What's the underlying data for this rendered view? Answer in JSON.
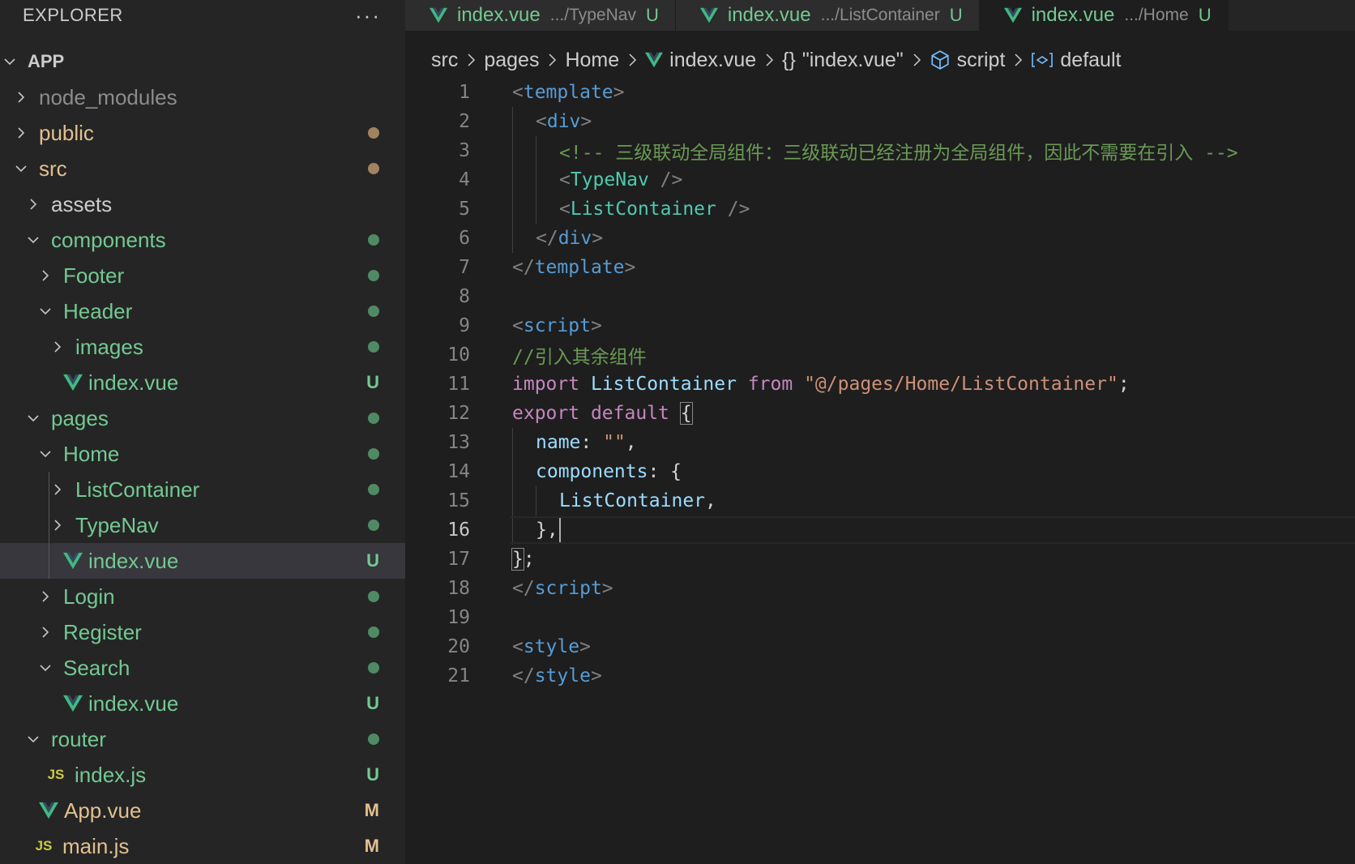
{
  "sidebar": {
    "title": "EXPLORER",
    "more": "···",
    "tree": [
      {
        "label": "APP",
        "indent": 0,
        "chevron": "down",
        "color": "white",
        "bold": true
      },
      {
        "label": "node_modules",
        "indent": 1,
        "chevron": "right",
        "color": "grey"
      },
      {
        "label": "public",
        "indent": 1,
        "chevron": "right",
        "color": "yellow",
        "status": "dot",
        "status_color": "#a0835f"
      },
      {
        "label": "src",
        "indent": 1,
        "chevron": "down",
        "color": "yellow",
        "status": "dot",
        "status_color": "#a0835f"
      },
      {
        "label": "assets",
        "indent": 2,
        "chevron": "right",
        "color": "white"
      },
      {
        "label": "components",
        "indent": 2,
        "chevron": "down",
        "color": "green",
        "status": "dot",
        "status_color": "#4f8a63"
      },
      {
        "label": "Footer",
        "indent": 3,
        "chevron": "right",
        "color": "green",
        "status": "dot",
        "status_color": "#4f8a63"
      },
      {
        "label": "Header",
        "indent": 3,
        "chevron": "down",
        "color": "green",
        "status": "dot",
        "status_color": "#4f8a63"
      },
      {
        "label": "images",
        "indent": 4,
        "chevron": "right",
        "color": "green",
        "status": "dot",
        "status_color": "#4f8a63"
      },
      {
        "label": "index.vue",
        "indent": 4,
        "icon": "vue",
        "color": "green",
        "status": "U",
        "status_color": "#73c991"
      },
      {
        "label": "pages",
        "indent": 2,
        "chevron": "down",
        "color": "green",
        "status": "dot",
        "status_color": "#4f8a63"
      },
      {
        "label": "Home",
        "indent": 3,
        "chevron": "down",
        "color": "green",
        "status": "dot",
        "status_color": "#4f8a63"
      },
      {
        "label": "ListContainer",
        "indent": 4,
        "chevron": "right",
        "color": "green",
        "status": "dot",
        "status_color": "#4f8a63",
        "guide": true
      },
      {
        "label": "TypeNav",
        "indent": 4,
        "chevron": "right",
        "color": "green",
        "status": "dot",
        "status_color": "#4f8a63",
        "guide": true
      },
      {
        "label": "index.vue",
        "indent": 4,
        "icon": "vue",
        "color": "green",
        "status": "U",
        "status_color": "#73c991",
        "selected": true,
        "guide": true
      },
      {
        "label": "Login",
        "indent": 3,
        "chevron": "right",
        "color": "green",
        "status": "dot",
        "status_color": "#4f8a63"
      },
      {
        "label": "Register",
        "indent": 3,
        "chevron": "right",
        "color": "green",
        "status": "dot",
        "status_color": "#4f8a63"
      },
      {
        "label": "Search",
        "indent": 3,
        "chevron": "down",
        "color": "green",
        "status": "dot",
        "status_color": "#4f8a63"
      },
      {
        "label": "index.vue",
        "indent": 4,
        "icon": "vue",
        "color": "green",
        "status": "U",
        "status_color": "#73c991"
      },
      {
        "label": "router",
        "indent": 2,
        "chevron": "down",
        "color": "green",
        "status": "dot",
        "status_color": "#4f8a63"
      },
      {
        "label": "index.js",
        "indent": 3,
        "icon": "js",
        "color": "green",
        "status": "U",
        "status_color": "#73c991"
      },
      {
        "label": "App.vue",
        "indent": 2,
        "icon": "vue",
        "color": "yellow",
        "status": "M",
        "status_color": "#e2c08d"
      },
      {
        "label": "main.js",
        "indent": 2,
        "icon": "js",
        "color": "yellow",
        "status": "M",
        "status_color": "#e2c08d"
      }
    ]
  },
  "tabs": [
    {
      "name": "index.vue",
      "path": ".../TypeNav",
      "status": "U",
      "active": false
    },
    {
      "name": "index.vue",
      "path": ".../ListContainer",
      "status": "U",
      "active": false
    },
    {
      "name": "index.vue",
      "path": ".../Home",
      "status": "U",
      "active": true
    }
  ],
  "breadcrumb": [
    {
      "label": "src",
      "icon": ""
    },
    {
      "label": "pages",
      "icon": ""
    },
    {
      "label": "Home",
      "icon": ""
    },
    {
      "label": "index.vue",
      "icon": "vue-icon"
    },
    {
      "label": "\"index.vue\"",
      "icon": "braces-icon"
    },
    {
      "label": "script",
      "icon": "cube-icon"
    },
    {
      "label": "default",
      "icon": "symbol-variable-icon"
    }
  ],
  "editor": {
    "current_line": 16,
    "lines": [
      {
        "n": "1",
        "indent": 0,
        "tokens": [
          [
            "br",
            "<"
          ],
          [
            "tag",
            "template"
          ],
          [
            "br",
            ">"
          ]
        ]
      },
      {
        "n": "2",
        "indent": 1,
        "tokens": [
          [
            "br",
            "<"
          ],
          [
            "tag",
            "div"
          ],
          [
            "br",
            ">"
          ]
        ]
      },
      {
        "n": "3",
        "indent": 2,
        "tokens": [
          [
            "com",
            "<!-- 三级联动全局组件：三级联动已经注册为全局组件，因此不需要在引入 -->"
          ]
        ]
      },
      {
        "n": "4",
        "indent": 2,
        "tokens": [
          [
            "br",
            "<"
          ],
          [
            "comp",
            "TypeNav"
          ],
          [
            "plain",
            " "
          ],
          [
            "br",
            "/>"
          ]
        ]
      },
      {
        "n": "5",
        "indent": 2,
        "tokens": [
          [
            "br",
            "<"
          ],
          [
            "comp",
            "ListContainer"
          ],
          [
            "plain",
            " "
          ],
          [
            "br",
            "/>"
          ]
        ]
      },
      {
        "n": "6",
        "indent": 1,
        "tokens": [
          [
            "br",
            "</"
          ],
          [
            "tag",
            "div"
          ],
          [
            "br",
            ">"
          ]
        ]
      },
      {
        "n": "7",
        "indent": 0,
        "tokens": [
          [
            "br",
            "</"
          ],
          [
            "tag",
            "template"
          ],
          [
            "br",
            ">"
          ]
        ]
      },
      {
        "n": "8",
        "indent": 0,
        "tokens": []
      },
      {
        "n": "9",
        "indent": 0,
        "tokens": [
          [
            "br",
            "<"
          ],
          [
            "tag",
            "script"
          ],
          [
            "br",
            ">"
          ]
        ]
      },
      {
        "n": "10",
        "indent": 0,
        "tokens": [
          [
            "com",
            "//引入其余组件"
          ]
        ]
      },
      {
        "n": "11",
        "indent": 0,
        "tokens": [
          [
            "kw",
            "import"
          ],
          [
            "plain",
            " "
          ],
          [
            "var",
            "ListContainer"
          ],
          [
            "plain",
            " "
          ],
          [
            "kw",
            "from"
          ],
          [
            "plain",
            " "
          ],
          [
            "str",
            "\"@/pages/Home/ListContainer\""
          ],
          [
            "plain",
            ";"
          ]
        ]
      },
      {
        "n": "12",
        "indent": 0,
        "tokens": [
          [
            "kw",
            "export"
          ],
          [
            "plain",
            " "
          ],
          [
            "kw",
            "default"
          ],
          [
            "plain",
            " "
          ],
          [
            "bracket",
            "{"
          ]
        ]
      },
      {
        "n": "13",
        "indent": 1,
        "tokens": [
          [
            "var",
            "name"
          ],
          [
            "plain",
            ": "
          ],
          [
            "str",
            "\"\""
          ],
          [
            "plain",
            ","
          ]
        ]
      },
      {
        "n": "14",
        "indent": 1,
        "tokens": [
          [
            "var",
            "components"
          ],
          [
            "plain",
            ": {"
          ]
        ]
      },
      {
        "n": "15",
        "indent": 2,
        "tokens": [
          [
            "var",
            "ListContainer"
          ],
          [
            "plain",
            ","
          ]
        ]
      },
      {
        "n": "16",
        "indent": 1,
        "tokens": [
          [
            "plain",
            "},"
          ],
          [
            "cursor",
            ""
          ]
        ]
      },
      {
        "n": "17",
        "indent": 0,
        "tokens": [
          [
            "bracket",
            "}"
          ],
          [
            "plain",
            ";"
          ]
        ]
      },
      {
        "n": "18",
        "indent": 0,
        "tokens": [
          [
            "br",
            "</"
          ],
          [
            "tag",
            "script"
          ],
          [
            "br",
            ">"
          ]
        ]
      },
      {
        "n": "19",
        "indent": 0,
        "tokens": []
      },
      {
        "n": "20",
        "indent": 0,
        "tokens": [
          [
            "br",
            "<"
          ],
          [
            "tag",
            "style"
          ],
          [
            "br",
            ">"
          ]
        ]
      },
      {
        "n": "21",
        "indent": 0,
        "tokens": [
          [
            "br",
            "</"
          ],
          [
            "tag",
            "style"
          ],
          [
            "br",
            ">"
          ]
        ]
      }
    ]
  },
  "colors": {
    "vue_green": "#41b883",
    "vue_dark": "#35495e",
    "git_untracked": "#73c991",
    "git_modified": "#e2c08d"
  }
}
